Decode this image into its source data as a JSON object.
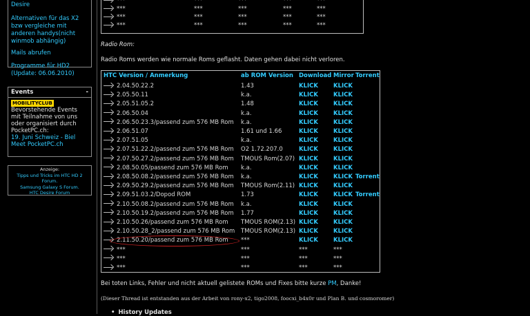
{
  "sidebar": {
    "top_links": [
      "Desire",
      "Alternativen für das X2 bzw vergleiche mit anderen handys(nicht winmob abhängig)",
      "Mails abrufen",
      "Programme für HD2 (Update: 06.06.2010)"
    ],
    "events": {
      "title": "Events",
      "toggle": "-",
      "logo": "MOBILITYCLUB",
      "text": "Bevorstehende Events mit Teilnahme von uns oder organisiert durch PocketPC.ch:",
      "event_link": "19. Juni Schweiz - Biel Meet PocketPC.ch"
    },
    "ads": {
      "title": "Anzeige:",
      "line1": "Tipps und Tricks im HTC HD 2 Forum.",
      "line2": "Samsung Galaxy S Forum.",
      "line3": "HTC Desire Forum"
    }
  },
  "top_table": {
    "rows": [
      [
        "***",
        "***",
        "***",
        "***",
        "***"
      ],
      [
        "***",
        "***",
        "***",
        "***",
        "***"
      ],
      [
        "***",
        "***",
        "***",
        "***",
        "***"
      ],
      [
        "***",
        "***",
        "***",
        "***",
        "***"
      ]
    ]
  },
  "radio": {
    "heading": "Radio Rom:",
    "intro": "Radio Roms werden wie normale Roms geflasht. Daten gehen dabei nicht verloren.",
    "headers": [
      "HTC Version / Anmerkung",
      "ab ROM Version",
      "Download",
      "Mirror",
      "Torrent"
    ],
    "rows": [
      {
        "v": "2.04.50.22.2",
        "r": "1.43",
        "d": "KLICK",
        "m": "KLICK",
        "t": ""
      },
      {
        "v": "2.05.50.11",
        "r": "k.a.",
        "d": "KLICK",
        "m": "KLICK",
        "t": ""
      },
      {
        "v": "2.05.51.05.2",
        "r": "1.48",
        "d": "KLICK",
        "m": "KLICK",
        "t": ""
      },
      {
        "v": "2.06.50.04",
        "r": "k.a.",
        "d": "KLICK",
        "m": "KLICK",
        "t": ""
      },
      {
        "v": "2.06.50.23.3/passend zum 576 MB Rom",
        "r": "k.a.",
        "d": "KLICK",
        "m": "KLICK",
        "t": ""
      },
      {
        "v": "2.06.51.07",
        "r": "1.61 und 1.66",
        "d": "KLICK",
        "m": "KLICK",
        "t": ""
      },
      {
        "v": "2.07.51.05",
        "r": "k.a.",
        "d": "KLICK",
        "m": "KLICK",
        "t": ""
      },
      {
        "v": "2.07.51.22.2/passend zum 576 MB Rom",
        "r": "O2 1.72.207.0",
        "d": "KLICK",
        "m": "KLICK",
        "t": ""
      },
      {
        "v": "2.07.50.27.2/passend zum 576 MB Rom",
        "r": "TMOUS Rom(2.07)",
        "d": "KLICK",
        "m": "KLICK",
        "t": ""
      },
      {
        "v": "2.08.50.05/passend zum 576 MB Rom",
        "r": "k.a.",
        "d": "KLICK",
        "m": "KLICK",
        "t": ""
      },
      {
        "v": "2.08.50.08.2/passend zum 576 MB Rom",
        "r": "k.a.",
        "d": "KLICK",
        "m": "KLICK",
        "t": "Torrent"
      },
      {
        "v": "2.09.50.29.2/passend zum 576 MB Rom",
        "r": "TMOUS Rom(2.11)",
        "d": "KLICK",
        "m": "KLICK",
        "t": ""
      },
      {
        "v": "2.09.51.03.2/Dopod ROM",
        "r": "1.73",
        "d": "KLICK",
        "m": "KLICK",
        "t": "Torrent"
      },
      {
        "v": "2.10.50.08.2/passend zum 576 MB Rom",
        "r": "k.a.",
        "d": "KLICK",
        "m": "KLICK",
        "t": ""
      },
      {
        "v": "2.10.50.19.2/passend zum 576 MB Rom",
        "r": "1.77",
        "d": "KLICK",
        "m": "KLICK",
        "t": ""
      },
      {
        "v": "2.10.50.26/passend zum 576 MB Rom",
        "r": "TMOUS ROM(2.13)",
        "d": "KLICK",
        "m": "KLICK",
        "t": ""
      },
      {
        "v": "2.10.50.28_2/passend zum 576 MB Rom",
        "r": "TMOUS ROM(2.13)",
        "d": "KLICK",
        "m": "KLICK",
        "t": ""
      },
      {
        "v": "2.11.50.20/passend zum 576 MB Rom",
        "r": "***",
        "d": "KLICK",
        "m": "KLICK",
        "t": ""
      },
      {
        "v": "***",
        "r": "***",
        "d": "***",
        "m": "***",
        "t": ""
      },
      {
        "v": "***",
        "r": "***",
        "d": "***",
        "m": "***",
        "t": ""
      },
      {
        "v": "***",
        "r": "***",
        "d": "***",
        "m": "***",
        "t": ""
      }
    ]
  },
  "footer": {
    "dead_links_prefix": "Bei toten Links, Fehler und nicht aktuell gelistete ROMs und Fixes bitte kurze ",
    "pm_link": "PM",
    "dead_links_suffix": ", Danke!",
    "thread_note": "(Dieser Thread ist entstanden aus der Arbeit von rony-x2, tigo2008, foocxi_b4x0r und Plan B. und cosmoromer)",
    "history": "History Updates"
  },
  "colors": {
    "link": "#33ccff",
    "background": "#000000",
    "highlight_circle": "#cc2222"
  }
}
